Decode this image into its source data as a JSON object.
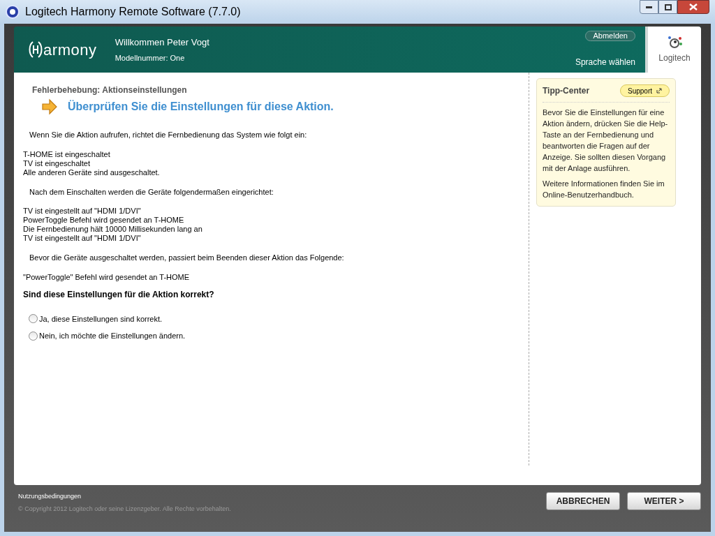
{
  "window": {
    "title": "Logitech Harmony Remote Software (7.7.0)"
  },
  "header": {
    "logo": "armony",
    "welcome": "Willkommen Peter Vogt",
    "model": "Modellnummer: One",
    "logout": "Abmelden",
    "language": "Sprache wählen",
    "brand": "Logitech"
  },
  "page": {
    "breadcrumb": "Fehlerbehebung:  Aktionseinstellungen",
    "heading": "Überprüfen Sie die Einstellungen für diese Aktion.",
    "sections": [
      {
        "intro": "Wenn Sie die Aktion aufrufen, richtet die Fernbedienung das System wie folgt ein:",
        "lines": [
          "T-HOME ist eingeschaltet",
          "TV ist eingeschaltet",
          "Alle anderen Geräte sind ausgeschaltet."
        ]
      },
      {
        "intro": "Nach dem Einschalten werden die Geräte folgendermaßen eingerichtet:",
        "lines": [
          "TV ist eingestellt auf \"HDMI 1/DVI\"",
          "PowerToggle Befehl wird gesendet an T-HOME",
          "Die Fernbedienung hält 10000 Millisekunden lang an",
          "TV ist eingestellt auf \"HDMI 1/DVI\""
        ]
      },
      {
        "intro": "Bevor die Geräte ausgeschaltet werden, passiert beim Beenden dieser Aktion das Folgende:",
        "lines": [
          "\"PowerToggle\" Befehl wird gesendet an T-HOME"
        ]
      }
    ],
    "question": "Sind diese Einstellungen für die Aktion korrekt?",
    "options": [
      {
        "label": "Ja, diese Einstellungen sind korrekt.",
        "selected": false
      },
      {
        "label": "Nein, ich möchte die Einstellungen ändern.",
        "selected": false
      }
    ]
  },
  "tips": {
    "title": "Tipp-Center",
    "support": "Support",
    "paragraphs": [
      "Bevor Sie die Einstellungen für eine Aktion ändern, drücken Sie die Help-Taste an der Fernbedienung und beantworten die Fragen auf der Anzeige. Sie sollten diesen Vorgang mit der Anlage ausführen.",
      "Weitere Informationen finden Sie im Online-Benutzerhandbuch."
    ]
  },
  "footer": {
    "terms": "Nutzungsbedingungen",
    "copyright": "© Copyright 2012 Logitech oder seine Lizenzgeber. Alle Rechte vorbehalten.",
    "buttons": [
      "ABBRECHEN",
      "WEITER >"
    ]
  }
}
